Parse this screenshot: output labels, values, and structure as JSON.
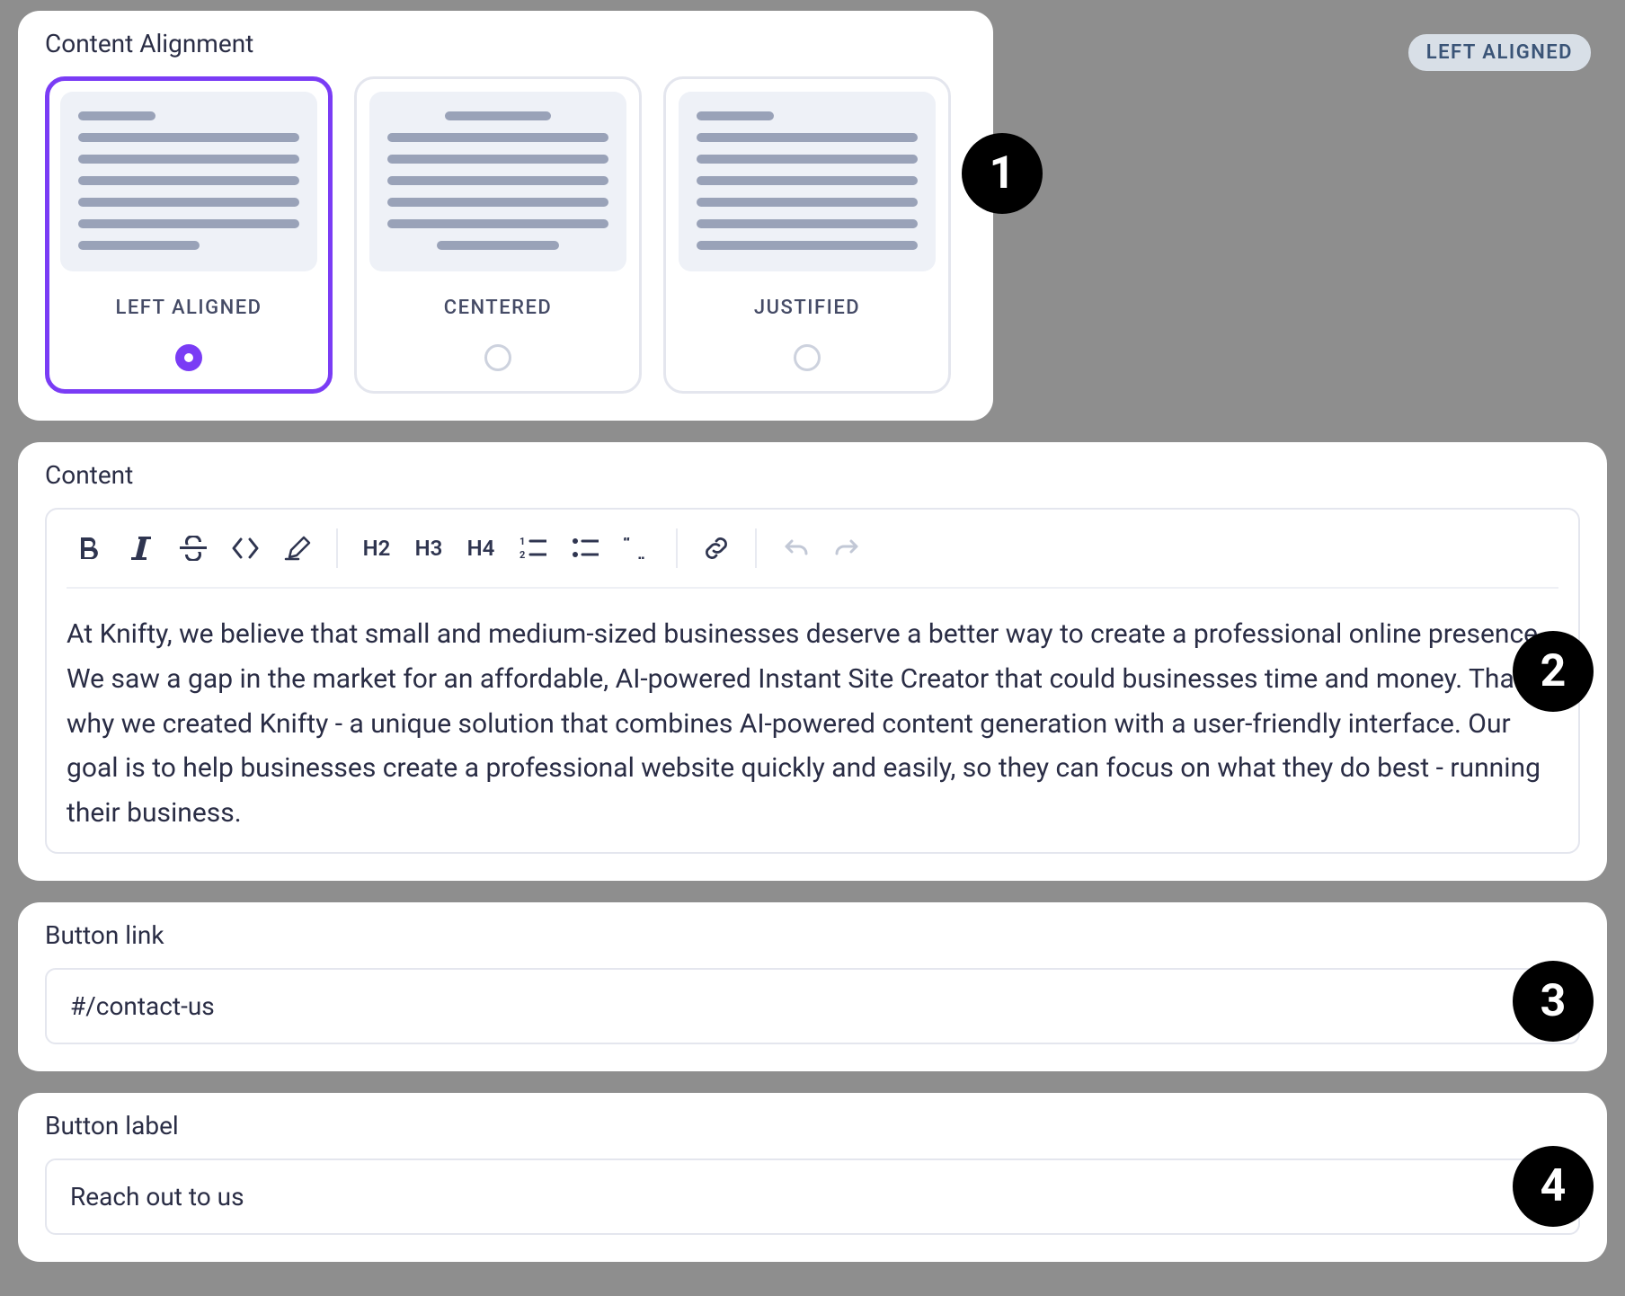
{
  "topStatus": "LEFT ALIGNED",
  "alignment": {
    "title": "Content Alignment",
    "options": [
      {
        "label": "LEFT ALIGNED",
        "selected": true
      },
      {
        "label": "CENTERED",
        "selected": false
      },
      {
        "label": "JUSTIFIED",
        "selected": false
      }
    ]
  },
  "content": {
    "title": "Content",
    "toolbar": {
      "h2": "H2",
      "h3": "H3",
      "h4": "H4"
    },
    "body": "At Knifty, we believe that small and medium-sized businesses deserve a better way to create a professional online presence. We saw a gap in the market for an affordable, AI-powered Instant Site Creator that could businesses time and money. That's why we created Knifty - a unique solution that combines AI-powered content generation with a user-friendly interface. Our goal is to help businesses create a professional website quickly and easily, so they can focus on what they do best - running their business."
  },
  "buttonLink": {
    "title": "Button link",
    "value": "#/contact-us"
  },
  "buttonLabel": {
    "title": "Button label",
    "value": "Reach out to us"
  },
  "badges": {
    "b1": "1",
    "b2": "2",
    "b3": "3",
    "b4": "4"
  }
}
